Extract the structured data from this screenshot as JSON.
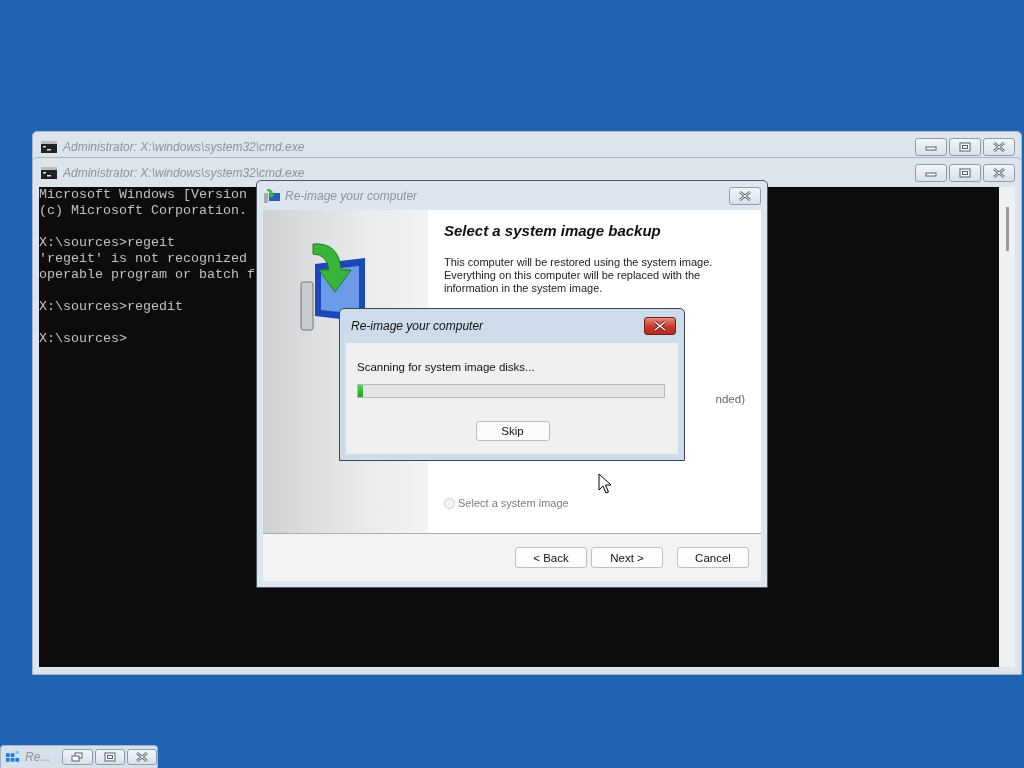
{
  "back_console": {
    "title": "Administrator: X:\\windows\\system32\\cmd.exe"
  },
  "console": {
    "title": "Administrator: X:\\windows\\system32\\cmd.exe",
    "blocks": [
      [
        "Microsoft Windows [Version",
        "(c) Microsoft Corporation."
      ],
      [
        "X:\\sources>regeit",
        "'regeit' is not recognized",
        "operable program or batch f"
      ],
      [
        "X:\\sources>regedit"
      ],
      [
        "X:\\sources>"
      ]
    ]
  },
  "wizard": {
    "title": "Re-image your computer",
    "heading": "Select a system image backup",
    "description": "This computer will be restored using the system image. Everything on this computer will be replaced with the information in the system image.",
    "option_fragment": "nded)",
    "radio": {
      "label": "Select a system image",
      "selected": false,
      "disabled": true
    },
    "buttons": [
      "< Back",
      "Next >",
      "Cancel"
    ]
  },
  "progress_dialog": {
    "title": "Re-image your computer",
    "message": "Scanning for system image disks...",
    "progress": {
      "level": 0.015
    },
    "button": "Skip"
  },
  "taskbar_item": {
    "title": "Re..."
  }
}
